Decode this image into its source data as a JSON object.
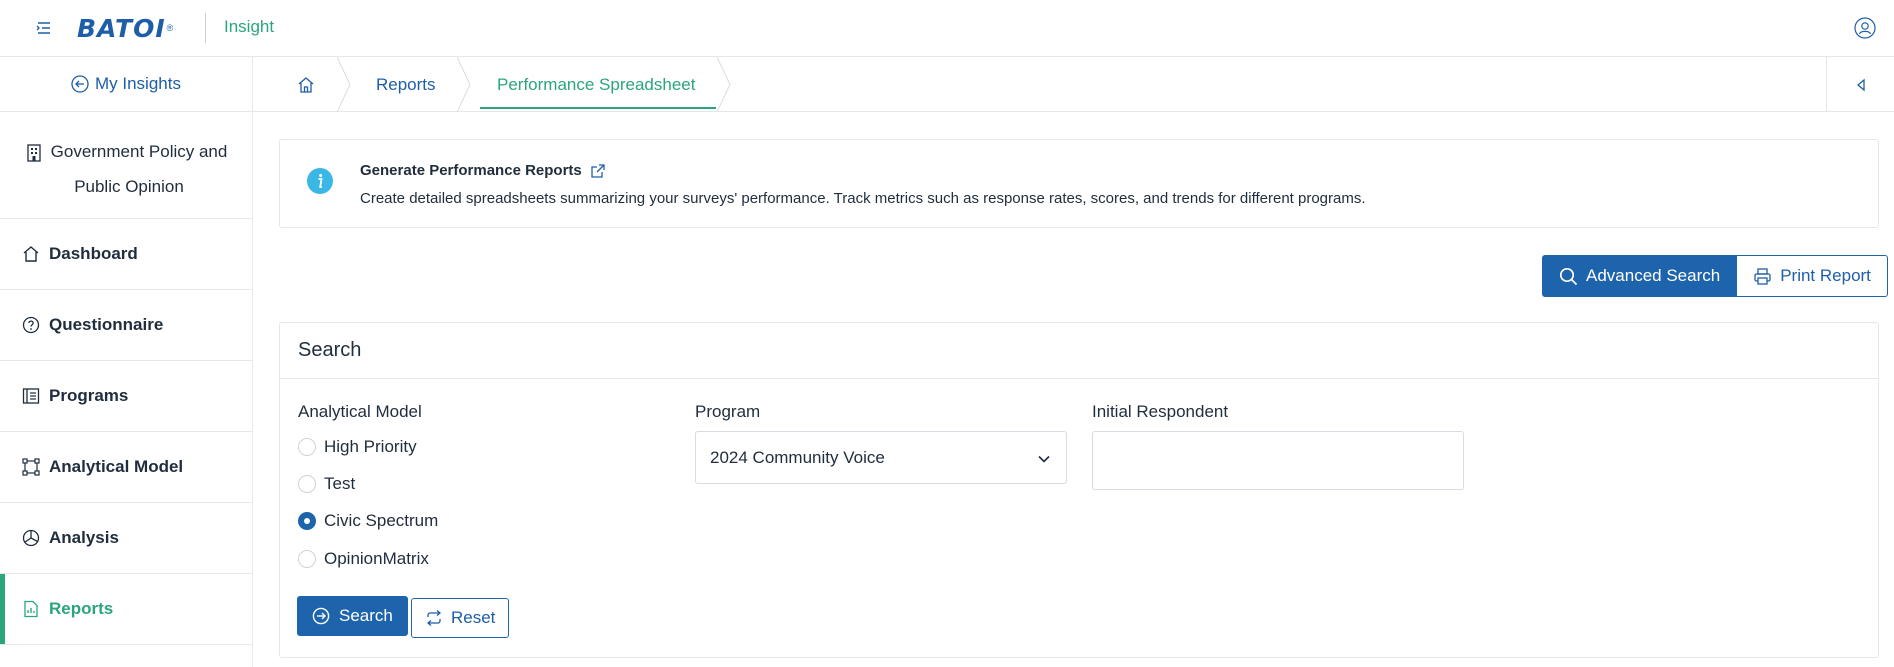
{
  "header": {
    "logo_text": "BATOI",
    "logo_registered": "®",
    "app_name": "Insight"
  },
  "sidebar": {
    "my_insights_label": "My Insights",
    "organization_line1": "Government Policy and",
    "organization_line2": "Public Opinion",
    "items": [
      {
        "label": "Dashboard",
        "icon": "home-icon"
      },
      {
        "label": "Questionnaire",
        "icon": "question-circle-icon"
      },
      {
        "label": "Programs",
        "icon": "list-book-icon"
      },
      {
        "label": "Analytical Model",
        "icon": "vector-nodes-icon"
      },
      {
        "label": "Analysis",
        "icon": "pie-chart-icon"
      },
      {
        "label": "Reports",
        "icon": "report-file-icon",
        "active": true
      }
    ]
  },
  "breadcrumb": {
    "home_icon": "home-icon",
    "items": [
      "Reports",
      "Performance Spreadsheet"
    ]
  },
  "info": {
    "title": "Generate Performance Reports",
    "description": "Create detailed spreadsheets summarizing your surveys' performance. Track metrics such as response rates, scores, and trends for different programs."
  },
  "actions": {
    "advanced_search_label": "Advanced Search",
    "print_report_label": "Print Report"
  },
  "search": {
    "title": "Search",
    "analytical_model_label": "Analytical Model",
    "analytical_model_options": [
      {
        "label": "High Priority",
        "checked": false
      },
      {
        "label": "Test",
        "checked": false
      },
      {
        "label": "Civic Spectrum",
        "checked": true
      },
      {
        "label": "OpinionMatrix",
        "checked": false
      }
    ],
    "program_label": "Program",
    "program_value": "2024 Community Voice",
    "initial_respondent_label": "Initial Respondent",
    "initial_respondent_value": "",
    "search_button_label": "Search",
    "reset_button_label": "Reset"
  },
  "colors": {
    "brand_blue": "#1e64ad",
    "accent_green": "#2aa57e",
    "info_cyan": "#3bb7e6"
  }
}
